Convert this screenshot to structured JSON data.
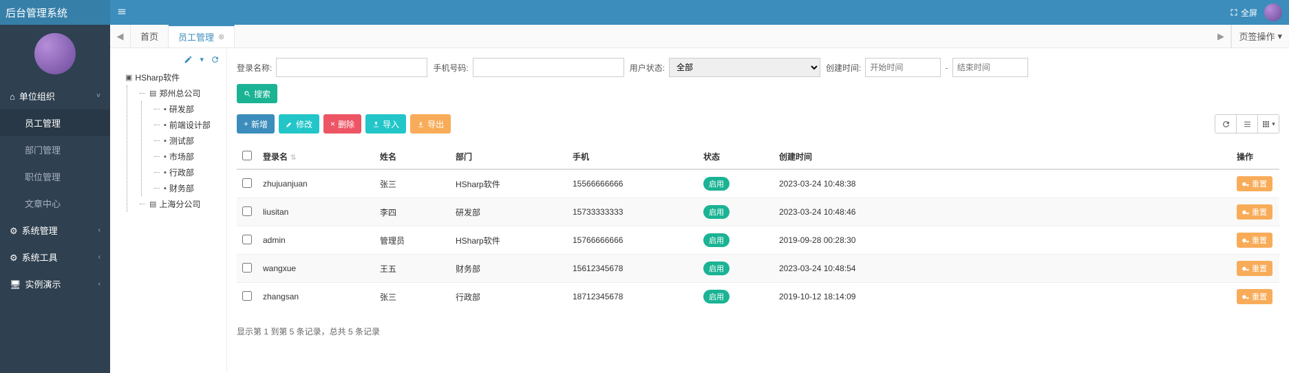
{
  "app": {
    "title": "后台管理系统",
    "fullscreen_label": "全屏"
  },
  "sidebar": {
    "groups": [
      {
        "label": "单位组织",
        "icon": "home",
        "expanded": true,
        "items": [
          {
            "label": "员工管理",
            "active": true
          },
          {
            "label": "部门管理"
          },
          {
            "label": "职位管理"
          },
          {
            "label": "文章中心"
          }
        ]
      },
      {
        "label": "系统管理",
        "icon": "gear"
      },
      {
        "label": "系统工具",
        "icon": "gears"
      },
      {
        "label": "实例演示",
        "icon": "desktop"
      }
    ]
  },
  "tabs": {
    "items": [
      {
        "label": "首页",
        "closable": false
      },
      {
        "label": "员工管理",
        "closable": true,
        "active": true
      }
    ],
    "ops_label": "页签操作"
  },
  "tree": {
    "root": "HSharp软件",
    "nodes": [
      {
        "label": "郑州总公司",
        "children": [
          "研发部",
          "前端设计部",
          "测试部",
          "市场部",
          "行政部",
          "财务部"
        ]
      },
      {
        "label": "上海分公司"
      }
    ]
  },
  "search": {
    "login_label": "登录名称:",
    "mobile_label": "手机号码:",
    "status_label": "用户状态:",
    "status_value": "全部",
    "time_label": "创建时间:",
    "time_start_ph": "开始时间",
    "time_end_ph": "结束时间",
    "sep": "-",
    "search_btn": "搜索"
  },
  "toolbar": {
    "add": "新增",
    "edit": "修改",
    "delete": "删除",
    "import": "导入",
    "export": "导出"
  },
  "table": {
    "cols": {
      "login": "登录名",
      "name": "姓名",
      "dept": "部门",
      "mobile": "手机",
      "status": "状态",
      "created": "创建时间",
      "ops": "操作"
    },
    "status_on": "启用",
    "reset_label": "重置",
    "rows": [
      {
        "login": "zhujuanjuan",
        "name": "张三",
        "dept": "HSharp软件",
        "mobile": "15566666666",
        "created": "2023-03-24 10:48:38"
      },
      {
        "login": "liusitan",
        "name": "李四",
        "dept": "研发部",
        "mobile": "15733333333",
        "created": "2023-03-24 10:48:46"
      },
      {
        "login": "admin",
        "name": "管理员",
        "dept": "HSharp软件",
        "mobile": "15766666666",
        "created": "2019-09-28 00:28:30"
      },
      {
        "login": "wangxue",
        "name": "王五",
        "dept": "财务部",
        "mobile": "15612345678",
        "created": "2023-03-24 10:48:54"
      },
      {
        "login": "zhangsan",
        "name": "张三",
        "dept": "行政部",
        "mobile": "18712345678",
        "created": "2019-10-12 18:14:09"
      }
    ],
    "footer": "显示第 1 到第 5 条记录，总共 5 条记录"
  }
}
